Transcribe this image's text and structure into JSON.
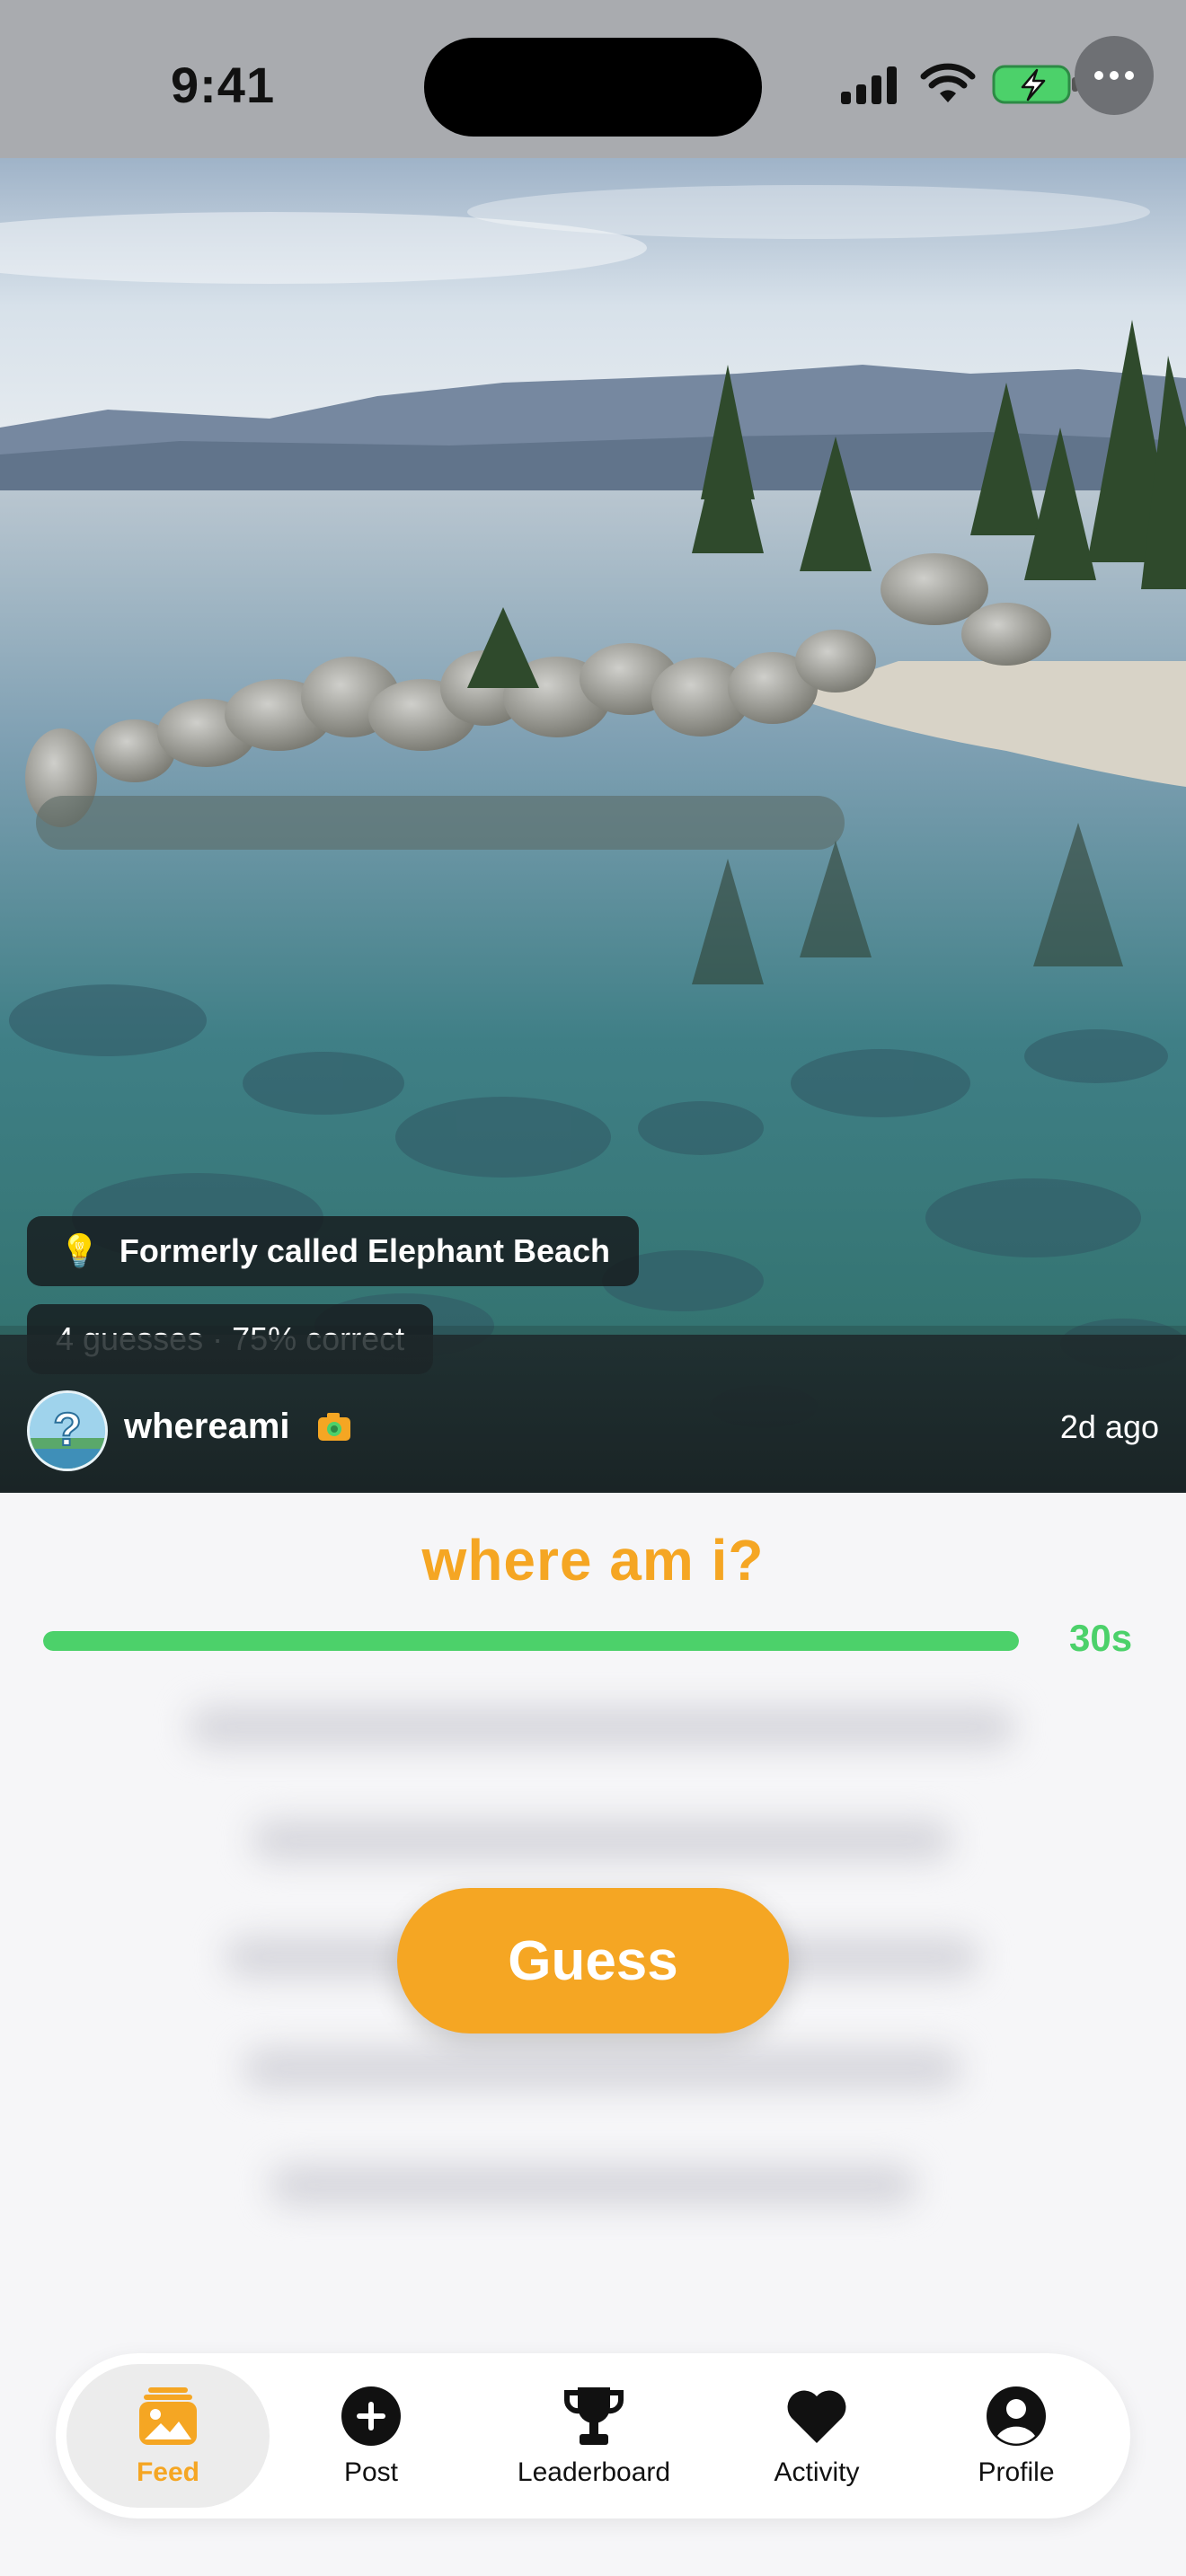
{
  "status_bar": {
    "time": "9:41",
    "icons": [
      "signal-icon",
      "wifi-icon",
      "battery-charging-icon",
      "more-icon"
    ]
  },
  "post": {
    "hint_icon": "lightbulb-icon",
    "hint": "Formerly called Elephant Beach",
    "stats": "4 guesses · 75% correct",
    "username": "whereami",
    "badge_icon": "camera-icon",
    "time_ago": "2d ago"
  },
  "game": {
    "prompt": "where am i?",
    "timer_label": "30s",
    "timer_fraction": 1.0,
    "guess_label": "Guess"
  },
  "tabs": [
    {
      "label": "Feed",
      "icon": "photo-feed-icon",
      "active": true
    },
    {
      "label": "Post",
      "icon": "plus-circle-icon",
      "active": false
    },
    {
      "label": "Leaderboard",
      "icon": "trophy-icon",
      "active": false
    },
    {
      "label": "Activity",
      "icon": "heart-icon",
      "active": false
    },
    {
      "label": "Profile",
      "icon": "profile-icon",
      "active": false
    }
  ],
  "colors": {
    "accent": "#f5a623",
    "timer": "#4cd16a",
    "status_bar_bg": "#a9abaf"
  }
}
